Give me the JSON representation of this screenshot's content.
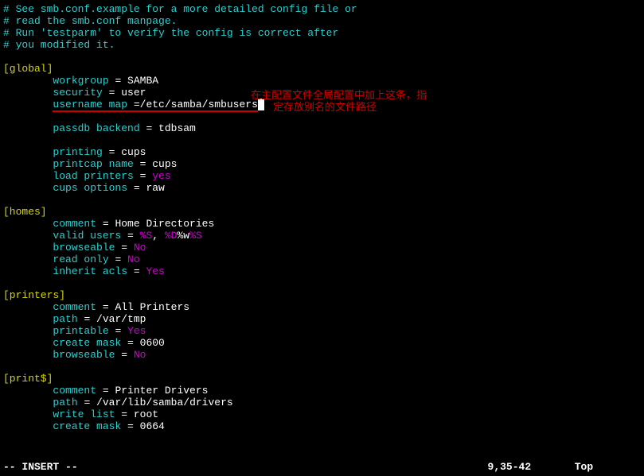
{
  "comments": {
    "l1": "# See smb.conf.example for a more detailed config file or",
    "l2": "# read the smb.conf manpage.",
    "l3": "# Run 'testparm' to verify the config is correct after",
    "l4": "# you modified it."
  },
  "sections": {
    "global": "[global]",
    "homes": "[homes]",
    "printers": "[printers]",
    "prints": "[print$]"
  },
  "global": {
    "workgroup_k": "workgroup",
    "workgroup_v": "SAMBA",
    "security_k": "security",
    "security_v": "user",
    "usermap_k": "username map",
    "usermap_v": "/etc/samba/smbusers",
    "passdb_k": "passdb backend",
    "passdb_v": "tdbsam",
    "printing_k": "printing",
    "printing_v": "cups",
    "printcap_k": "printcap name",
    "printcap_v": "cups",
    "loadpr_k": "load printers",
    "loadpr_v": "yes",
    "cupsopt_k": "cups options",
    "cupsopt_v": "raw"
  },
  "homes": {
    "comment_k": "comment",
    "comment_v": "Home Directories",
    "valid_k": "valid users",
    "valid_p1": "%S",
    "valid_comma": ", ",
    "valid_p2": "%D",
    "valid_slash": "%w",
    "valid_p3": "%S",
    "browse_k": "browseable",
    "browse_v": "No",
    "ro_k": "read only",
    "ro_v": "No",
    "inh_k": "inherit acls",
    "inh_v": "Yes"
  },
  "printers": {
    "comment_k": "comment",
    "comment_v": "All Printers",
    "path_k": "path",
    "path_v": "/var/tmp",
    "printable_k": "printable",
    "printable_v": "Yes",
    "cmask_k": "create mask",
    "cmask_v": "0600",
    "browse_k": "browseable",
    "browse_v": "No"
  },
  "prints": {
    "comment_k": "comment",
    "comment_v": "Printer Drivers",
    "path_k": "path",
    "path_v": "/var/lib/samba/drivers",
    "wlist_k": "write list",
    "wlist_v": "root",
    "cmask_k": "create mask",
    "cmask_v": "0664"
  },
  "eq": " = ",
  "eq2": " =",
  "status": {
    "mode": "-- INSERT --",
    "pos": "9,35-42",
    "scroll": "Top"
  },
  "annotation": {
    "l1": "在主配置文件全局配置中加上这条，指",
    "l2": "定存放别名的文件路径"
  }
}
